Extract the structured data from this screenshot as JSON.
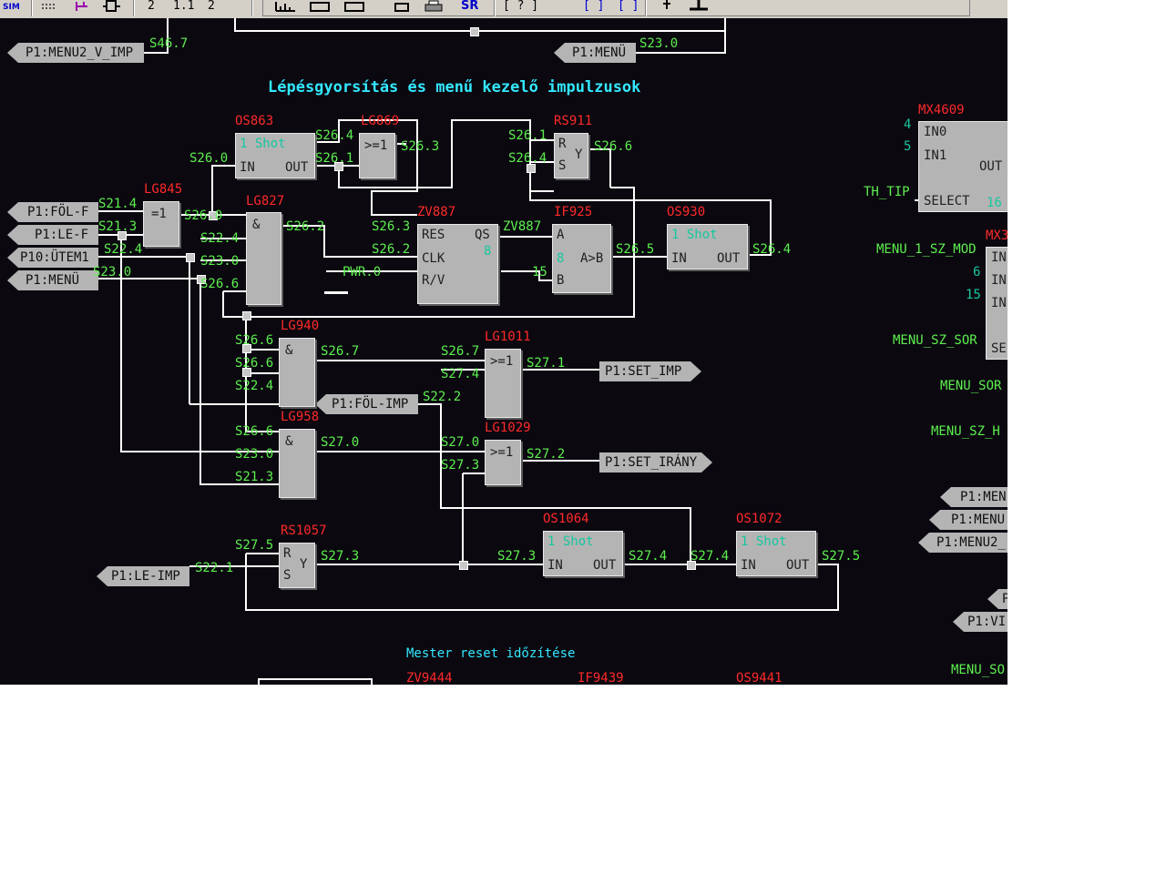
{
  "toolbar": {
    "sim_label": "SIM",
    "glyph_a": "2",
    "glyph_b": "1.1",
    "glyph_c": "2",
    "sr_label": "SR",
    "glyph_d": "[ ? ]",
    "glyph_e": "[ ]",
    "glyph_f": "[ ]"
  },
  "titles": {
    "main": "Lépésgyorsítás és menű kezelő impulzusok",
    "reset": "Mester reset időzítése"
  },
  "tags": {
    "menu2_v_imp": "P1:MENU2_V_IMP",
    "menu_top": "P1:MENÜ",
    "fol_f": "P1:FÖL-F",
    "le_f": "P1:LE-F",
    "utem1": "P10:ÜTEM1",
    "menu_left": "P1:MENÜ",
    "fol_imp": "P1:FÖL-IMP",
    "set_imp": "P1:SET_IMP",
    "set_irany": "P1:SET_IRÁNY",
    "le_imp": "P1:LE-IMP",
    "right_men1": "P1:MEN",
    "right_menu": "P1:MENU",
    "right_menu2": "P1:MENU2_",
    "right_p": "P",
    "right_vi": "P1:VI"
  },
  "blocks": {
    "os863": {
      "name": "OS863",
      "line1": "1 Shot",
      "in": "IN",
      "out": "OUT"
    },
    "lg869": {
      "name": "LG869",
      "op": ">=1"
    },
    "rs911": {
      "name": "RS911",
      "r": "R",
      "s": "S",
      "y": "Y"
    },
    "lg845": {
      "name": "LG845",
      "op": "=1"
    },
    "lg827": {
      "name": "LG827",
      "op": "&"
    },
    "zv887": {
      "name": "ZV887",
      "res": "RES",
      "clk": "CLK",
      "rv": "R/V",
      "qs": "QS",
      "val": "8"
    },
    "if925": {
      "name": "IF925",
      "a": "A",
      "b": "B",
      "cmp": "A>B",
      "val": "8"
    },
    "os930": {
      "name": "OS930",
      "line1": "1 Shot",
      "in": "IN",
      "out": "OUT"
    },
    "lg940": {
      "name": "LG940",
      "op": "&"
    },
    "lg1011": {
      "name": "LG1011",
      "op": ">=1"
    },
    "lg958": {
      "name": "LG958",
      "op": "&"
    },
    "lg1029": {
      "name": "LG1029",
      "op": ">=1"
    },
    "os1064": {
      "name": "OS1064",
      "line1": "1 Shot",
      "in": "IN",
      "out": "OUT"
    },
    "os1072": {
      "name": "OS1072",
      "line1": "1 Shot",
      "in": "IN",
      "out": "OUT"
    },
    "rs1057": {
      "name": "RS1057",
      "r": "R",
      "s": "S",
      "y": "Y"
    },
    "mx4609": {
      "name": "MX4609",
      "in0": "IN0",
      "in1": "IN1",
      "out": "OUT",
      "select": "SELECT",
      "val": "16",
      "n4": "4",
      "n5": "5"
    },
    "mx3": {
      "name": "MX3",
      "in_a": "IN",
      "in_b": "IN",
      "in_c": "IN",
      "se": "SE",
      "n6": "6",
      "n15": "15"
    },
    "zv9444": {
      "name": "ZV9444"
    },
    "if9439": {
      "name": "IF9439"
    },
    "os9441": {
      "name": "OS9441"
    }
  },
  "signals": {
    "s46_7": "S46.7",
    "s23_0_top": "S23.0",
    "s26_0": "S26.0",
    "s26_4_a": "S26.4",
    "s26_1_a": "S26.1",
    "s26_3_a": "S26.3",
    "s26_1_b": "S26.1",
    "s26_6_a": "S26.6",
    "s26_4_b": "S26.4",
    "s21_4": "S21.4",
    "s21_3": "S21.3",
    "s22_4_a": "S22.4",
    "s23_0_a": "S23.0",
    "s26_0_b": "S26.0",
    "s22_4_b": "S22.4",
    "s23_0_b": "S23.0",
    "s26_6_b": "S26.6",
    "s26_2_a": "S26.2",
    "s26_3_b": "S26.3",
    "s26_2_b": "S26.2",
    "pwr_0": "PWR.0",
    "zv887_out": "ZV887",
    "if925_b": "15",
    "s26_5": "S26.5",
    "s26_4_c": "S26.4",
    "s26_6_c": "S26.6",
    "s26_6_d": "S26.6",
    "s22_4_c": "S22.4",
    "s26_7_a": "S26.7",
    "s26_7_b": "S26.7",
    "s27_4_a": "S27.4",
    "s27_1": "S27.1",
    "s22_2": "S22.2",
    "s26_6_e": "S26.6",
    "s23_0_c": "S23.0",
    "s21_3_b": "S21.3",
    "s27_0_a": "S27.0",
    "s27_0_b": "S27.0",
    "s27_3_a": "S27.3",
    "s27_2": "S27.2",
    "s27_5_a": "S27.5",
    "s27_3_b": "S27.3",
    "s22_1": "S22.1",
    "s27_3_c": "S27.3",
    "s27_4_b": "S27.4",
    "s27_4_c": "S27.4",
    "s27_5_b": "S27.5",
    "th_tip": "TH_TIP",
    "menu_1_sz_mod": "MENU_1_SZ_MOD",
    "menu_sz_sor": "MENU_SZ_SOR",
    "menu_sor": "MENU_SOR",
    "menu_sz_h": "MENU_SZ_H",
    "menu_so": "MENU_SO"
  }
}
